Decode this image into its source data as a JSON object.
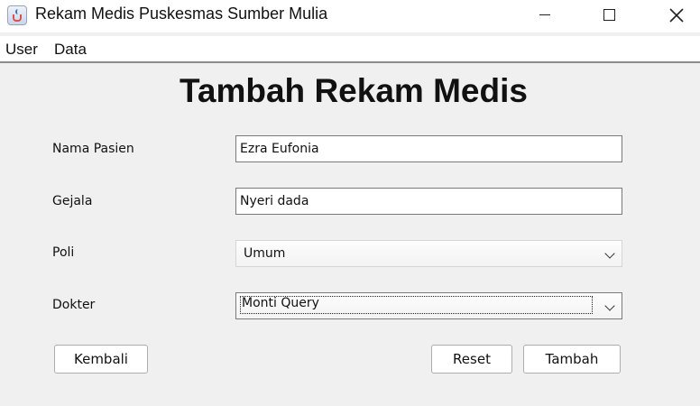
{
  "window": {
    "title": "Rekam Medis Puskesmas Sumber Mulia"
  },
  "menu": {
    "items": [
      "User",
      "Data"
    ]
  },
  "form": {
    "title": "Tambah Rekam Medis",
    "nama_pasien": {
      "label": "Nama Pasien",
      "value": "Ezra Eufonia"
    },
    "gejala": {
      "label": "Gejala",
      "value": "Nyeri dada"
    },
    "poli": {
      "label": "Poli",
      "value": "Umum"
    },
    "dokter": {
      "label": "Dokter",
      "value": "Monti Query"
    }
  },
  "buttons": {
    "kembali": "Kembali",
    "reset": "Reset",
    "tambah": "Tambah"
  }
}
